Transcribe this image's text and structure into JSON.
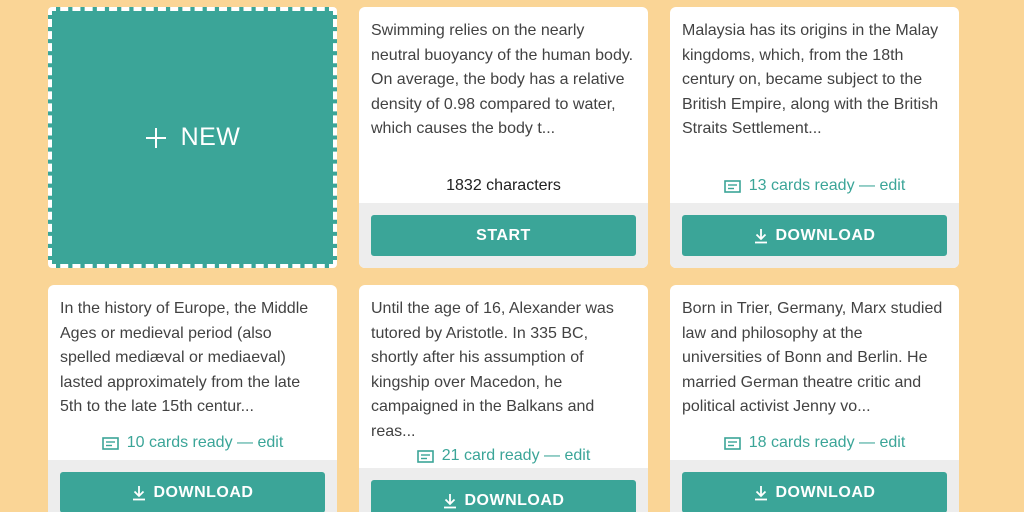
{
  "colors": {
    "background": "#fad596",
    "accent": "#3ba598",
    "card": "#ffffff",
    "footer": "#ededed"
  },
  "new_card": {
    "label": "NEW",
    "icon": "plus-icon"
  },
  "cards": [
    {
      "text": "Swimming relies on the nearly neutral buoyancy of the human body. On average, the body has a relative density of 0.98 compared to water, which causes the body t...",
      "meta": "1832 characters",
      "button": "START"
    },
    {
      "text": "Malaysia has its origins in the Malay kingdoms, which, from the 18th century on, became subject to the British Empire, along with the British Straits Settlement...",
      "meta": "13 cards ready — edit",
      "button": "DOWNLOAD"
    },
    {
      "text": "In the history of Europe, the Middle Ages or medieval period (also spelled mediæval or mediaeval) lasted approximately from the late 5th to the late 15th centur...",
      "meta": "10 cards ready — edit",
      "button": "DOWNLOAD"
    },
    {
      "text": "Until the age of 16, Alexander was tutored by Aristotle. In 335 BC, shortly after his assumption of kingship over Macedon, he campaigned in the Balkans and reas...",
      "meta": "21 card ready — edit",
      "button": "DOWNLOAD"
    },
    {
      "text": "Born in Trier, Germany, Marx studied law and philosophy at the universities of Bonn and Berlin. He married German theatre critic and political activist Jenny vo...",
      "meta": "18 cards ready — edit",
      "button": "DOWNLOAD"
    }
  ]
}
